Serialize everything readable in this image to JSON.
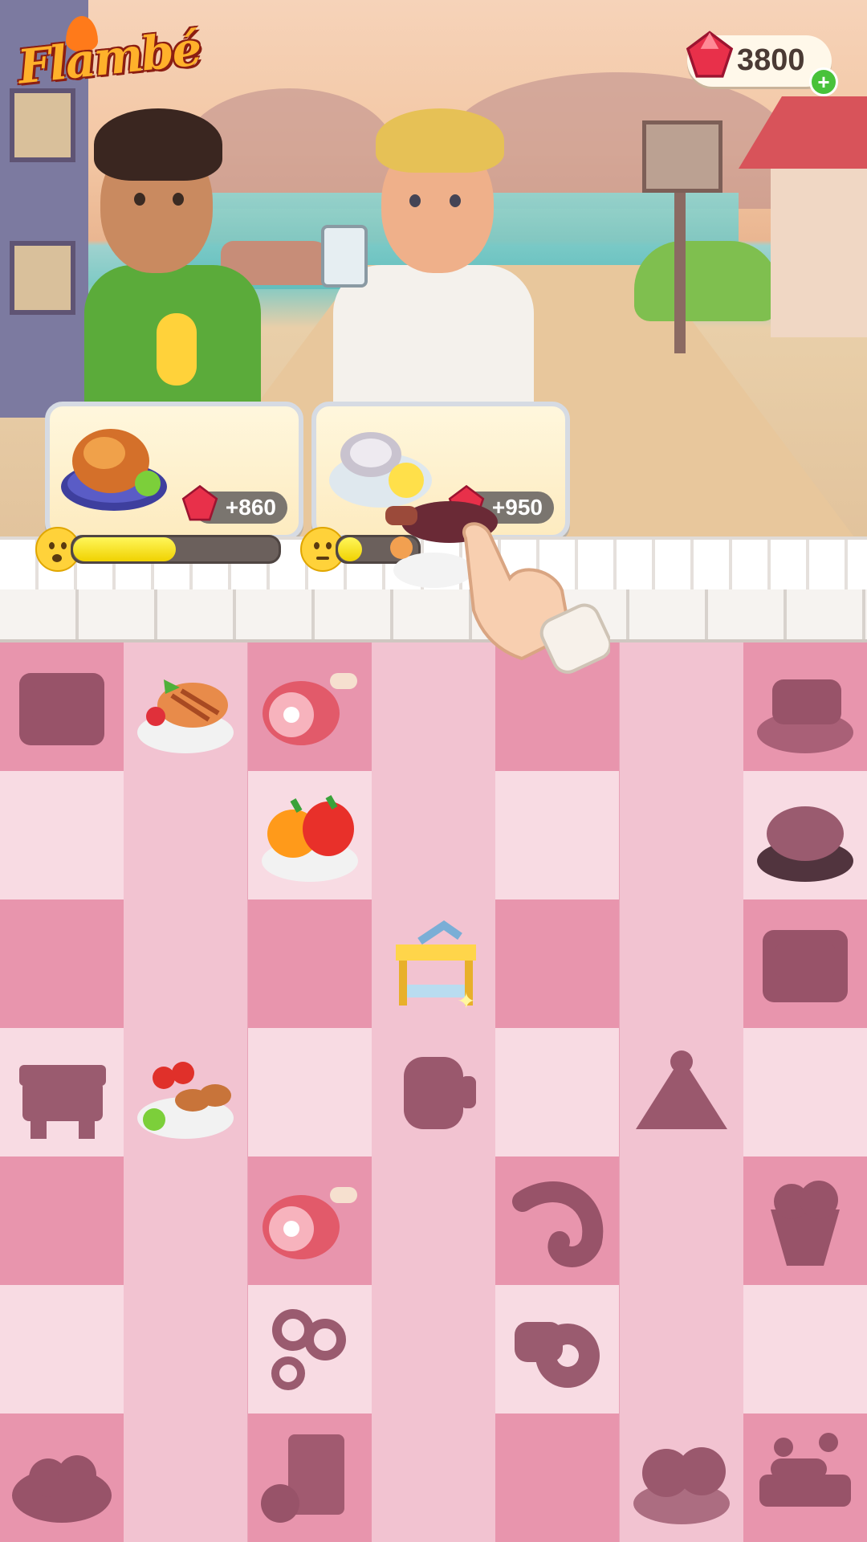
{
  "app": {
    "logo_text": "Flambé"
  },
  "currency": {
    "gems": "3800",
    "plus_label": "+"
  },
  "orders": [
    {
      "dish": "roast-chicken",
      "reward": "+860",
      "mood": "surprised",
      "patience": 0.5
    },
    {
      "dish": "oyster-with-lemon",
      "reward": "+950",
      "mood": "annoyed",
      "patience": 0.3
    }
  ],
  "colors": {
    "board_dark": "#e895ad",
    "board_light": "#f2c3d1",
    "gem": "#e8304a",
    "patience_fill": "#f4e000"
  },
  "board": {
    "columns": 7,
    "rows": 7,
    "items": [
      {
        "row": 0,
        "col": 0,
        "item": "oven-locked"
      },
      {
        "row": 0,
        "col": 1,
        "item": "grilled-chicken-plate"
      },
      {
        "row": 0,
        "col": 2,
        "item": "ham-leg"
      },
      {
        "row": 0,
        "col": 6,
        "item": "steak-plate-locked"
      },
      {
        "row": 1,
        "col": 2,
        "item": "bell-pepper-plate"
      },
      {
        "row": 1,
        "col": 6,
        "item": "sliced-meat-plate-locked"
      },
      {
        "row": 2,
        "col": 3,
        "item": "kitchen-table"
      },
      {
        "row": 2,
        "col": 6,
        "item": "oven-locked"
      },
      {
        "row": 3,
        "col": 0,
        "item": "grill-locked"
      },
      {
        "row": 3,
        "col": 1,
        "item": "skewers-plate"
      },
      {
        "row": 3,
        "col": 3,
        "item": "blender-locked"
      },
      {
        "row": 3,
        "col": 5,
        "item": "cake-tent-locked"
      },
      {
        "row": 4,
        "col": 2,
        "item": "ham-leg"
      },
      {
        "row": 4,
        "col": 4,
        "item": "shrimp-locked"
      },
      {
        "row": 4,
        "col": 6,
        "item": "ice-cream-cup-locked"
      },
      {
        "row": 5,
        "col": 2,
        "item": "onion-rings-locked"
      },
      {
        "row": 5,
        "col": 4,
        "item": "donut-locked"
      },
      {
        "row": 6,
        "col": 0,
        "item": "tomato-bowl-locked"
      },
      {
        "row": 6,
        "col": 2,
        "item": "apple-juice-locked"
      },
      {
        "row": 6,
        "col": 5,
        "item": "tomato-plate-locked"
      },
      {
        "row": 6,
        "col": 6,
        "item": "sausages-locked"
      }
    ]
  }
}
